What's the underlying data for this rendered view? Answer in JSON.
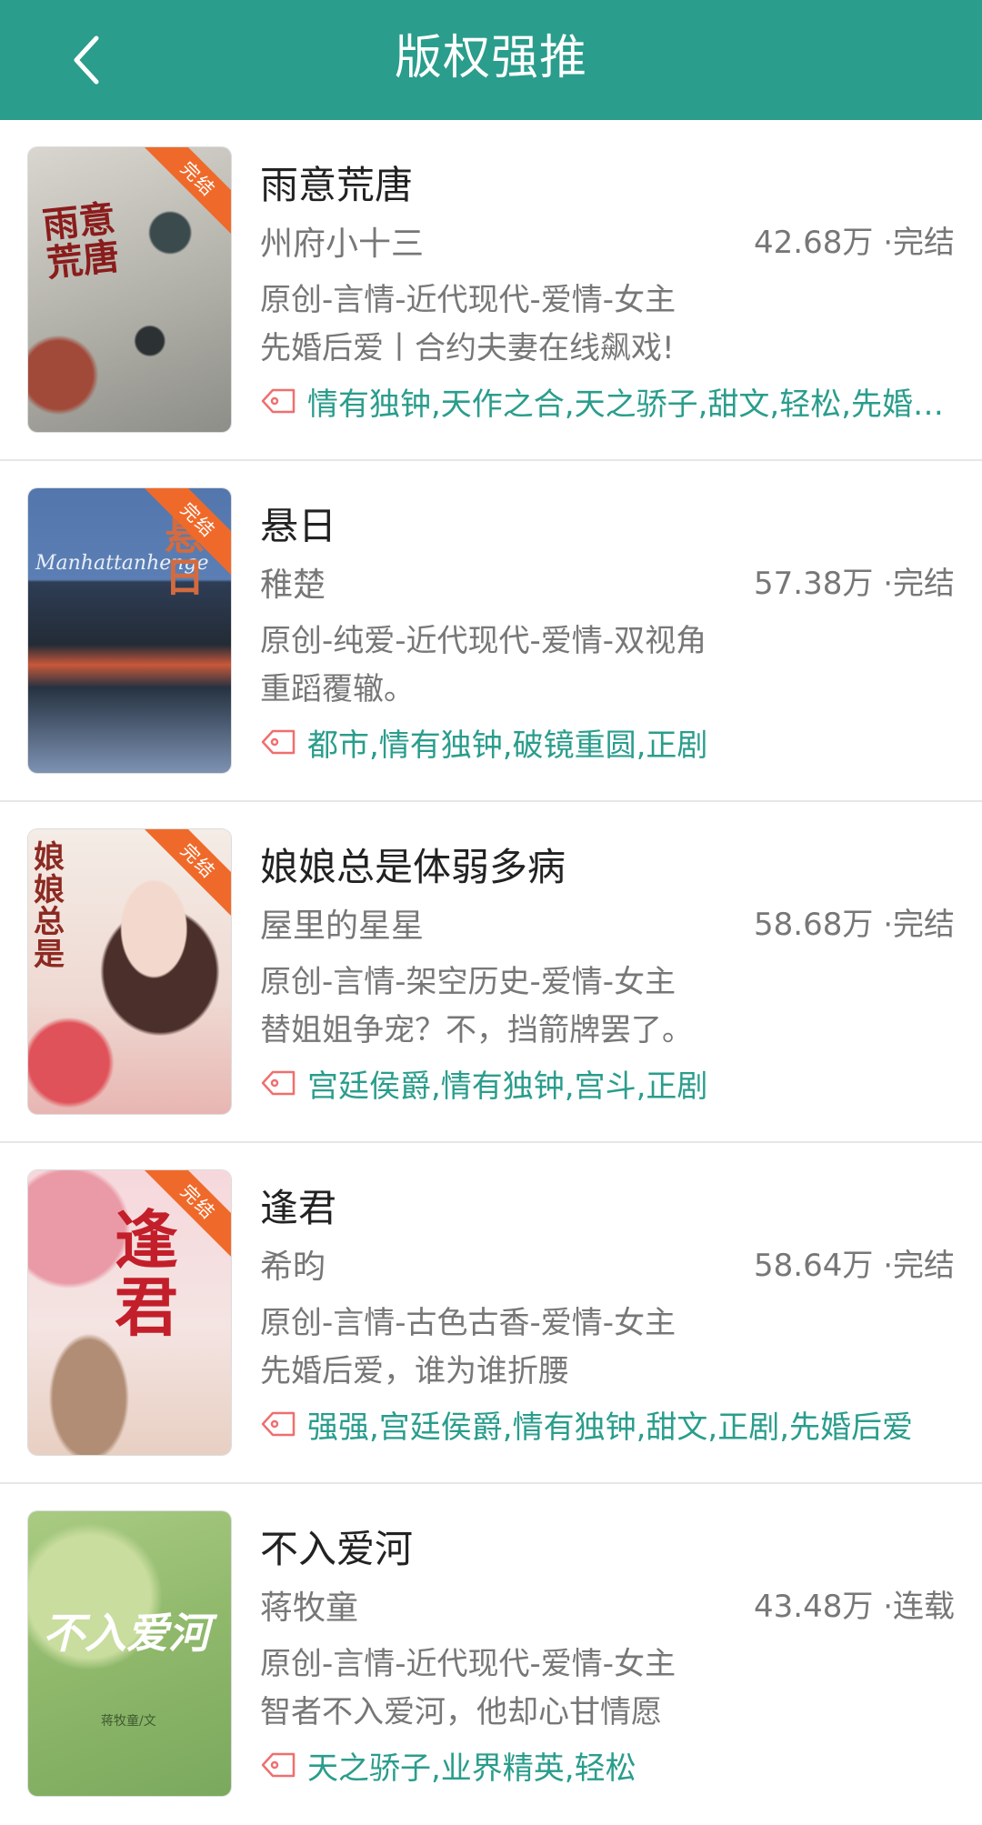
{
  "header": {
    "title": "版权强推"
  },
  "books": [
    {
      "title": "雨意荒唐",
      "author": "州府小十三",
      "stat": "42.68万 ·完结",
      "category": "原创-言情-近代现代-爱情-女主",
      "intro": "先婚后爱丨合约夫妻在线飙戏!",
      "tags": "情有独钟,天作之合,天之骄子,甜文,轻松,先婚后爱",
      "badge": "完结",
      "cover_text": "雨意荒唐"
    },
    {
      "title": "悬日",
      "author": "稚楚",
      "stat": "57.38万 ·完结",
      "category": "原创-纯爱-近代现代-爱情-双视角",
      "intro": "重蹈覆辙。",
      "tags": "都市,情有独钟,破镜重圆,正剧",
      "badge": "完结",
      "cover_text": "悬日",
      "cover_subtext": "Manhattanhenge"
    },
    {
      "title": "娘娘总是体弱多病",
      "author": "屋里的星星",
      "stat": "58.68万 ·完结",
      "category": "原创-言情-架空历史-爱情-女主",
      "intro": "替姐姐争宠？不，挡箭牌罢了。",
      "tags": "宫廷侯爵,情有独钟,宫斗,正剧",
      "badge": "完结",
      "cover_text": "娘娘总是"
    },
    {
      "title": "逢君",
      "author": "希昀",
      "stat": "58.64万 ·完结",
      "category": "原创-言情-古色古香-爱情-女主",
      "intro": "先婚后爱，谁为谁折腰",
      "tags": "强强,宫廷侯爵,情有独钟,甜文,正剧,先婚后爱",
      "badge": "完结",
      "cover_text": "逢君"
    },
    {
      "title": "不入爱河",
      "author": "蒋牧童",
      "stat": "43.48万 ·连载",
      "category": "原创-言情-近代现代-爱情-女主",
      "intro": "智者不入爱河，他却心甘情愿",
      "tags": "天之骄子,业界精英,轻松",
      "cover_text": "不入爱河",
      "cover_subtext": "蒋牧童/文"
    }
  ],
  "colors": {
    "accent": "#2a9d8c",
    "badge": "#ef6a2a",
    "tag_icon": "#ef6f6f"
  }
}
